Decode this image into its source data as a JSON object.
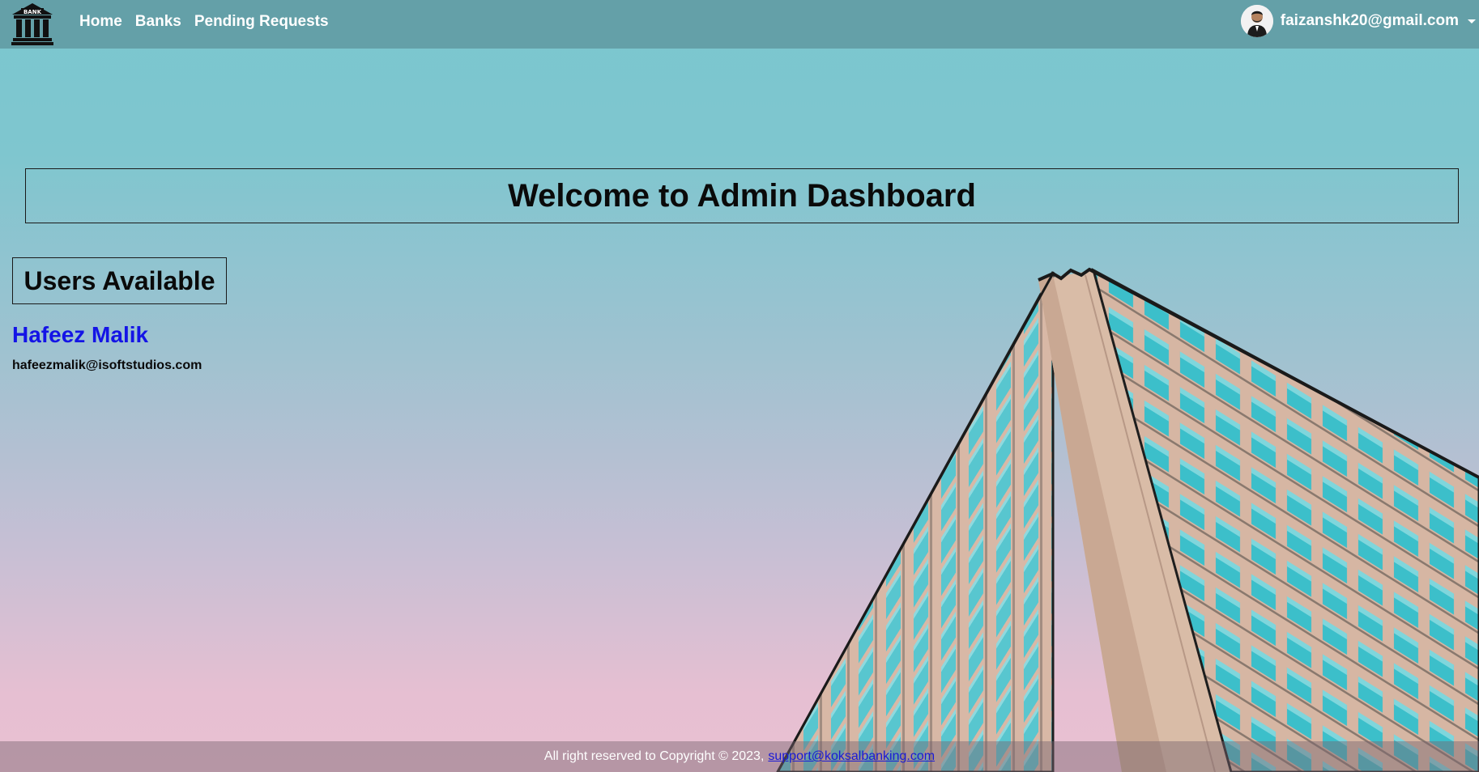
{
  "navbar": {
    "brand_icon": "bank-building-icon",
    "brand_label": "BANK",
    "links": [
      {
        "label": "Home"
      },
      {
        "label": "Banks"
      },
      {
        "label": "Pending Requests"
      }
    ],
    "profile": {
      "avatar_icon": "user-avatar",
      "email": "faizanshk20@gmail.com",
      "dropdown_icon": "caret-down-icon"
    }
  },
  "main": {
    "welcome_title": "Welcome to Admin Dashboard",
    "users_heading": "Users Available",
    "users": [
      {
        "name": "Hafeez Malik",
        "email": "hafeezmalik@isoftstudios.com"
      }
    ]
  },
  "footer": {
    "text": "All right reserved to Copyright © 2023,",
    "link": "support@koksalbanking.com"
  },
  "colors": {
    "navbar_bg": "#64a0a8",
    "user_link": "#1414e6",
    "sky_top": "#7ac7cf",
    "sky_bottom": "#e9c0d2"
  }
}
